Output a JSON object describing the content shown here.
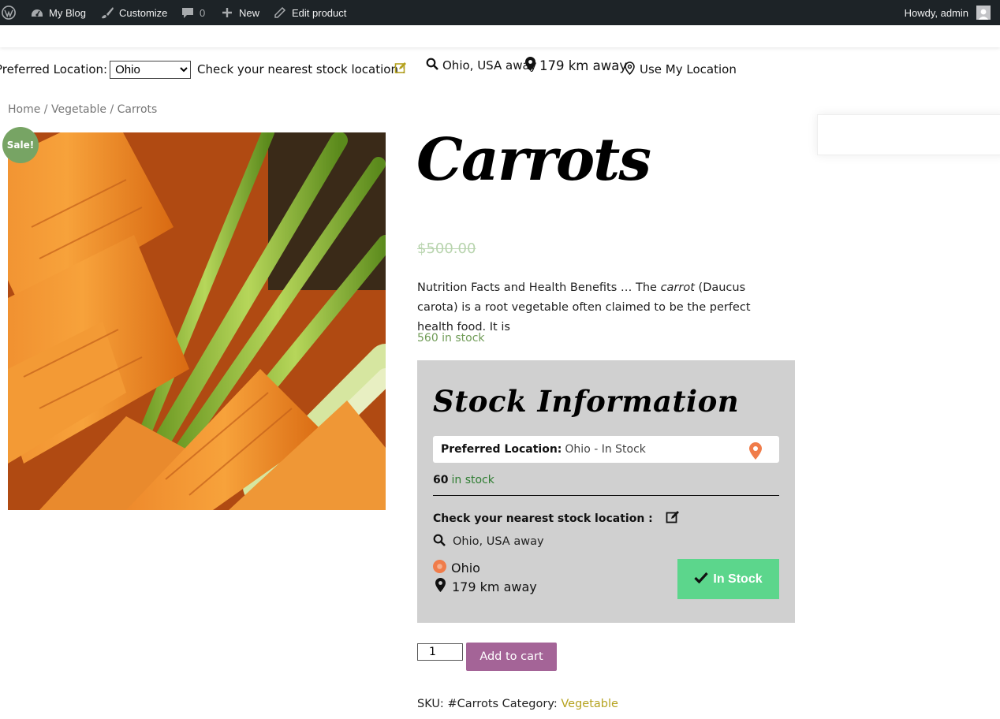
{
  "adminbar": {
    "site_name": "My Blog",
    "customize": "Customize",
    "comments_count": "0",
    "new_label": "New",
    "edit_label": "Edit product",
    "howdy": "Howdy, admin"
  },
  "location_bar": {
    "preferred_label": "Preferred Location:",
    "selected_location": "Ohio",
    "nearest_label": "Check your nearest stock location :",
    "search_value": "Ohio, USA away",
    "distance": "179 km away",
    "use_my_location": "Use My Location"
  },
  "breadcrumb": {
    "home": "Home",
    "sep": "/",
    "category": "Vegetable",
    "current": "Carrots"
  },
  "product": {
    "sale_badge": "Sale!",
    "title": "Carrots",
    "regular_price": "$500.00",
    "description_before": "Nutrition Facts and Health Benefits … The ",
    "description_em": "carrot",
    "description_after": " (Daucus carota) is a root vegetable often claimed to be the perfect health food. It is",
    "stock": "560 in stock"
  },
  "stock_info": {
    "heading": "Stock Information",
    "preferred_label": "Preferred Location:",
    "preferred_value": "Ohio - In Stock",
    "qty": "60",
    "qty_suffix": "in stock",
    "nearest_label": "Check your nearest stock location :",
    "search_value": "Ohio, USA away",
    "store_name": "Ohio",
    "distance": "179 km away",
    "status_button": "In Stock"
  },
  "cart": {
    "quantity": "1",
    "add_to_cart": "Add to cart"
  },
  "meta": {
    "sku_label": "SKU:",
    "sku_value": "#Carrots",
    "category_label": "Category:",
    "category_value": "Vegetable"
  },
  "colors": {
    "adminbar_bg": "#1d2327",
    "sale_badge": "#77a464",
    "stock_green": "#6f9b56",
    "instock_button": "#5cd68c",
    "add_to_cart": "#a46497",
    "category_link": "#b5a21e",
    "pin_orange": "#f07c4a",
    "stock_box_bg": "#d0d0d0"
  }
}
